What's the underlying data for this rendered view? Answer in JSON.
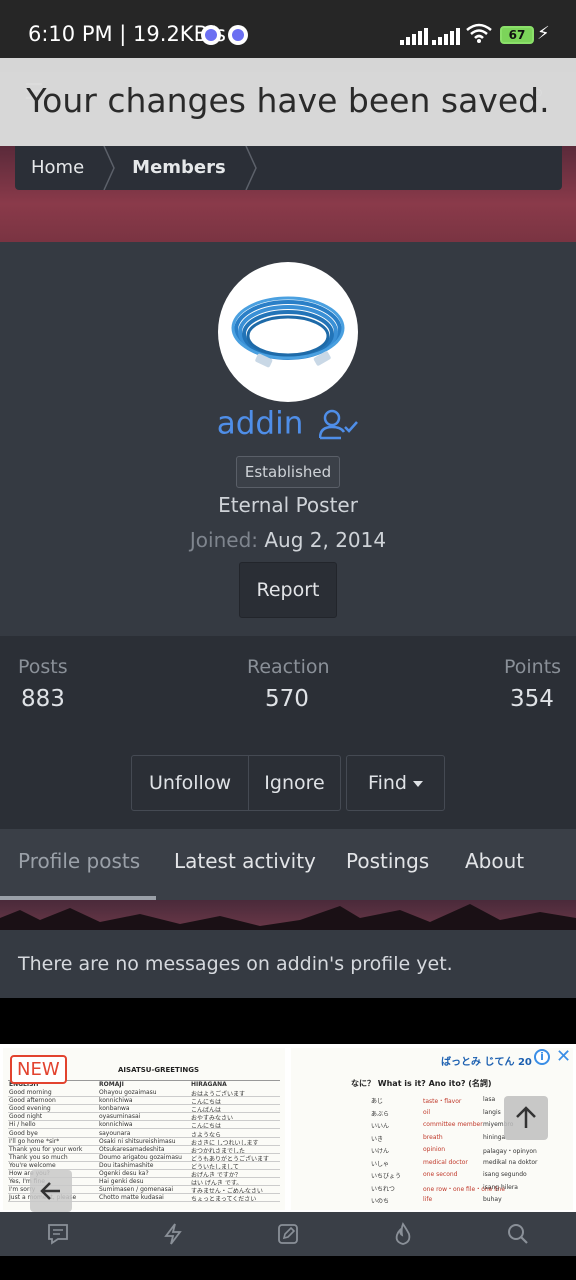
{
  "status_bar": {
    "time": "6:10 PM | 19.2KB/s",
    "battery": "67",
    "charging_icon": "charging-bolt-icon"
  },
  "toast": {
    "message": "Your changes have been saved."
  },
  "breadcrumb": {
    "home": "Home",
    "members": "Members"
  },
  "profile": {
    "username": "addin",
    "badge": "Established",
    "user_title": "Eternal Poster",
    "joined_label": "Joined:",
    "joined_date": "Aug 2, 2014",
    "report_label": "Report",
    "username_color": "#4f8ee8"
  },
  "stats": {
    "posts_label": "Posts",
    "posts_value": "883",
    "reaction_label": "Reaction",
    "reaction_value": "570",
    "points_label": "Points",
    "points_value": "354"
  },
  "actions": {
    "unfollow": "Unfollow",
    "ignore": "Ignore",
    "find": "Find"
  },
  "tabs": [
    "Profile posts",
    "Latest activity",
    "Postings",
    "About"
  ],
  "active_tab": "Profile posts",
  "messages": {
    "empty_text": "There are no messages on addin's profile yet."
  },
  "ad": {
    "new_label": "NEW",
    "left_title": "AISATSU-GREETINGS",
    "columns": [
      "ENGLISH",
      "ROMAJI",
      "HIRAGANA"
    ],
    "rows": [
      [
        "Good morning",
        "Ohayou gozaimasu",
        "おはようございます"
      ],
      [
        "Good afternoon",
        "konnichiwa",
        "こんにちは"
      ],
      [
        "Good evening",
        "konbanwa",
        "こんばんは"
      ],
      [
        "Good night",
        "oyasuminasai",
        "おやすみなさい"
      ],
      [
        "Hi / hello",
        "konnichiwa",
        "こんにちは"
      ],
      [
        "Good bye",
        "sayounara",
        "さようなら"
      ],
      [
        "I'll go home *sir*",
        "Osaki ni shitsureishimasu",
        "おさきに しつれいします"
      ],
      [
        "Thank you for your work",
        "Otsukaresamadeshita",
        "おつかれさまでした"
      ],
      [
        "Thank you so much",
        "Doumo arigatou gozaimasu",
        "どうもありがとうございます"
      ],
      [
        "You're welcome",
        "Dou itashimashite",
        "どういたしまして"
      ],
      [
        "How are you?",
        "Ogenki desu ka?",
        "おげんき ですか？"
      ],
      [
        "Yes, I'm fine",
        "Hai genki desu",
        "はい げんき です。"
      ],
      [
        "I'm sorry",
        "Sumimasen / gomenasai",
        "すみません・ごめんなさい"
      ],
      [
        "Just a moment, please",
        "Chotto matte kudasai",
        "ちょっとまってください"
      ]
    ],
    "right_title": "ばっとみ じてん 20",
    "right_subtitle": "なに？ What is it? Ano ito? (名詞)",
    "right_rows": [
      [
        "あじ",
        "taste・flavor",
        "lasa"
      ],
      [
        "あぶら",
        "oil",
        "langis"
      ],
      [
        "いいん",
        "committee member",
        "miyembro"
      ],
      [
        "いき",
        "breath",
        "hininga"
      ],
      [
        "いけん",
        "opinion",
        "palagay・opinyon"
      ],
      [
        "いしゃ",
        "medical doctor",
        "medikal na doktor"
      ],
      [
        "いちびょう",
        "one second",
        "isang segundo"
      ],
      [
        "いちれつ",
        "one row・one file・one line",
        "isang hilera"
      ],
      [
        "いのち",
        "life",
        "buhay"
      ]
    ]
  },
  "bottom_nav": [
    "chat-icon",
    "bolt-icon",
    "edit-icon",
    "fire-icon",
    "search-icon"
  ]
}
